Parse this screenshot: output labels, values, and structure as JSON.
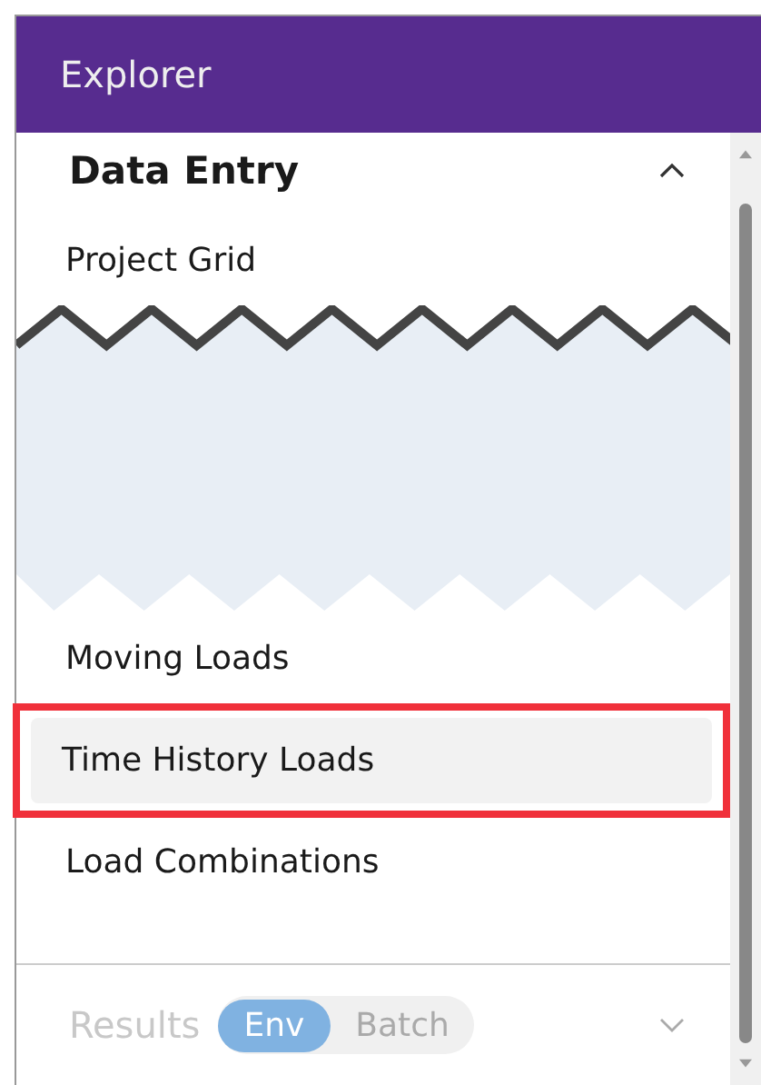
{
  "window": {
    "title": "Explorer"
  },
  "section": {
    "title": "Data Entry",
    "expanded": true,
    "items": [
      {
        "label": "Project Grid",
        "selected": false,
        "highlighted": false
      },
      {
        "kind": "break"
      },
      {
        "label": "Moving Loads",
        "selected": false,
        "highlighted": false
      },
      {
        "label": "Time History Loads",
        "selected": true,
        "highlighted": true
      },
      {
        "label": "Load Combinations",
        "selected": false,
        "highlighted": false
      }
    ]
  },
  "results": {
    "label": "Results",
    "disabled": true,
    "expanded": false,
    "toggle": [
      {
        "label": "Env",
        "selected": true
      },
      {
        "label": "Batch",
        "selected": false
      }
    ]
  }
}
